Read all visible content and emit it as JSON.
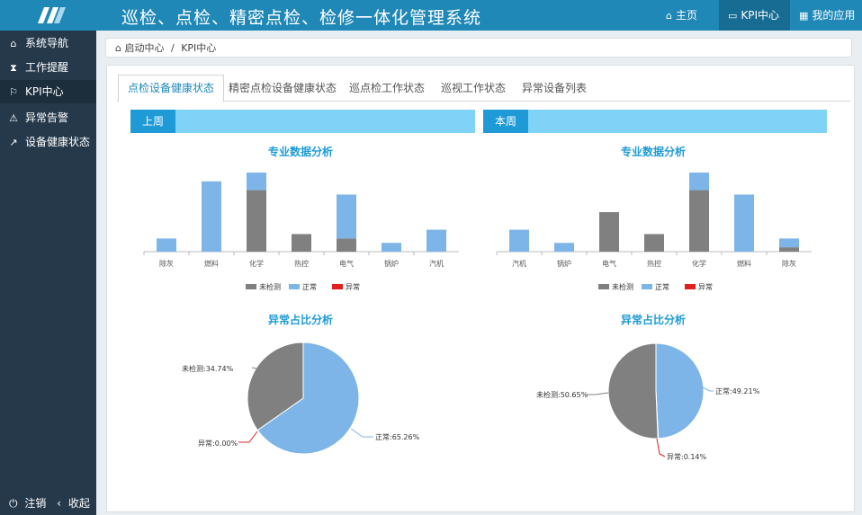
{
  "app": {
    "title": "巡检、点检、精密点检、检修一体化管理系统"
  },
  "topnav": [
    {
      "label": "主页",
      "icon": "home-icon"
    },
    {
      "label": "KPI中心",
      "icon": "monitor-icon"
    },
    {
      "label": "我的应用",
      "icon": "grid-icon"
    }
  ],
  "sidebar": {
    "items": [
      {
        "label": "系统导航",
        "icon": "home-icon"
      },
      {
        "label": "工作提醒",
        "icon": "hourglass-icon"
      },
      {
        "label": "KPI中心",
        "icon": "flag-icon"
      },
      {
        "label": "异常告警",
        "icon": "warning-icon"
      },
      {
        "label": "设备健康状态",
        "icon": "share-icon"
      }
    ],
    "logout": "注销",
    "collapse": "收起"
  },
  "breadcrumb": {
    "home": "启动中心",
    "sep": "/",
    "current": "KPI中心"
  },
  "tabs": [
    "点检设备健康状态",
    "精密点检设备健康状态",
    "巡点检工作状态",
    "巡视工作状态",
    "异常设备列表"
  ],
  "weeks": {
    "last": "上周",
    "this": "本周"
  },
  "chart_titles": {
    "bar": "专业数据分析",
    "pie": "异常占比分析"
  },
  "colors": {
    "unchecked": "#808080",
    "normal": "#7eb5e8",
    "abnormal": "#e01f1f"
  },
  "chart_data": [
    {
      "type": "bar",
      "title": "专业数据分析",
      "categories": [
        "除灰",
        "燃料",
        "化学",
        "热控",
        "电气",
        "锅炉",
        "汽机"
      ],
      "series": [
        {
          "name": "未检测",
          "values": [
            0,
            0,
            14,
            4,
            3,
            0,
            0
          ]
        },
        {
          "name": "正常",
          "values": [
            3,
            16,
            4,
            0,
            10,
            2,
            5
          ]
        },
        {
          "name": "异常",
          "values": [
            0,
            0,
            0,
            0,
            0,
            0,
            0
          ]
        }
      ],
      "ylim": [
        0,
        18
      ],
      "legend": "bottom"
    },
    {
      "type": "bar",
      "title": "专业数据分析",
      "categories": [
        "汽机",
        "锅炉",
        "电气",
        "热控",
        "化学",
        "燃料",
        "除灰"
      ],
      "series": [
        {
          "name": "未检测",
          "values": [
            0,
            0,
            9,
            4,
            14,
            0,
            1
          ]
        },
        {
          "name": "正常",
          "values": [
            5,
            2,
            0,
            0,
            4,
            13,
            2
          ]
        },
        {
          "name": "异常",
          "values": [
            0,
            0,
            0,
            0,
            0,
            0,
            0
          ]
        }
      ],
      "ylim": [
        0,
        18
      ],
      "legend": "bottom"
    },
    {
      "type": "pie",
      "title": "异常占比分析",
      "slices": [
        {
          "name": "未检测",
          "label": "未检测:34.74%",
          "value": 34.74
        },
        {
          "name": "正常",
          "label": "正常:65.26%",
          "value": 65.26
        },
        {
          "name": "异常",
          "label": "异常:0.00%",
          "value": 0.0
        }
      ]
    },
    {
      "type": "pie",
      "title": "异常占比分析",
      "slices": [
        {
          "name": "未检测",
          "label": "未检测:50.65%",
          "value": 50.65
        },
        {
          "name": "正常",
          "label": "正常:49.21%",
          "value": 49.21
        },
        {
          "name": "异常",
          "label": "异常:0.14%",
          "value": 0.14
        }
      ]
    }
  ]
}
